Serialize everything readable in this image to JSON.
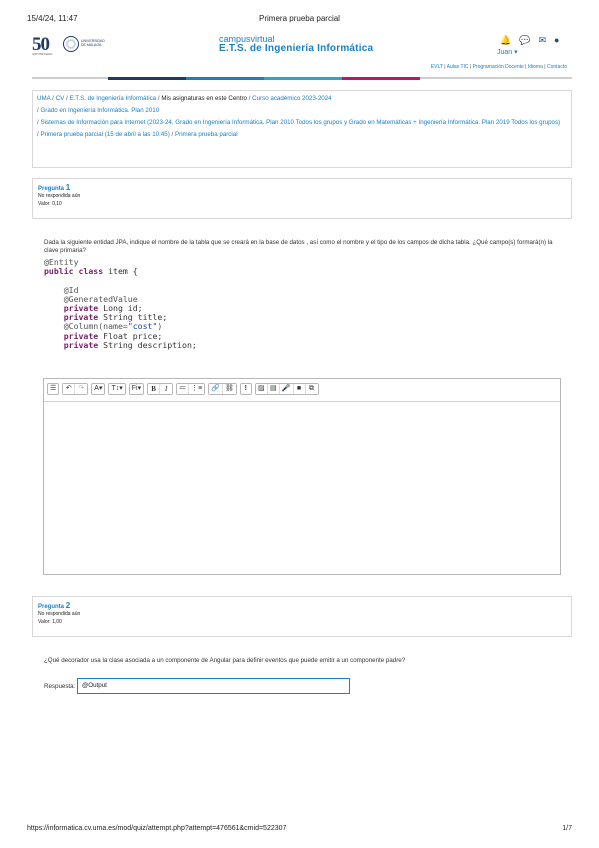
{
  "print_header": {
    "date": "15/4/24, 11:47",
    "title": "Primera prueba parcial"
  },
  "logo": {
    "fifty": "50",
    "fifty_sub": "ANIVERSARIO",
    "univ_line1": "UNIVERSIDAD",
    "univ_line2": "DE MÁLAGA"
  },
  "brand": {
    "line1": "campusvirtual",
    "line2": "E.T.S. de Ingeniería Informática"
  },
  "user": {
    "name": "Juan",
    "caret": "▾"
  },
  "icons": [
    "bell-icon",
    "chat-icon",
    "mail-icon",
    "help-icon"
  ],
  "top_links": [
    "EVLT",
    "Aulas TIC",
    "Programación Docente",
    "Idioma",
    "Contacto"
  ],
  "colors": {
    "accent": "#1b7fc4",
    "bar": [
      "#1f3a66",
      "#1b7fc4",
      "#2aa6c9",
      "#c0136b",
      "#cfcfcf"
    ]
  },
  "breadcrumb": {
    "items1": [
      "UMA",
      "CV",
      "E.T.S. de Ingeniería Informática"
    ],
    "current": "Mis asignaturas en este Centro",
    "after": "Curso académico 2023-2024",
    "line2": "Grado en Ingeniería Informática. Plan 2010",
    "line3": "Sistemas de Información para Internet (2023-24, Grado en Ingeniería Informática. Plan 2010 Todos los grupos y Grado en Matemáticas + Ingeniería Informática. Plan 2019 Todos los grupos)",
    "line4a": "Primera prueba parcial (15 de abril a las 10:45)",
    "line4b": "Primera prueba parcial"
  },
  "q1": {
    "label": "Pregunta",
    "number": "1",
    "status": "No respondida aún",
    "value": "Valor: 0,10",
    "text": "Dada la siguiente entidad JPA, indique el nombre de la tabla que se creará en la base de datos , así como el nombre y el tipo de los campos de dicha tabla. ¿Qué campo(s) formará(n) la clave primaria?",
    "code": {
      "l1": "@Entity",
      "l2_kw": "public class",
      "l2_rest": " item {",
      "l3": "@Id",
      "l4": "@GeneratedValue",
      "l5_kw": "private",
      "l5_rest": " Long id;",
      "l6_kw": "private",
      "l6_rest": " String title;",
      "l7_a": "@Column(name=",
      "l7_str": "\"cost\"",
      "l7_b": ")",
      "l8_kw": "private",
      "l8_rest": " Float price;",
      "l9_kw": "private",
      "l9_rest": " String description;"
    }
  },
  "toolbar": {
    "b1": "☰",
    "b2": "↶",
    "b3": "↷",
    "b4": "A▾",
    "b5": "T↕▾",
    "b6": "Fi▾",
    "b7": "B",
    "b8": "I",
    "b9": "≔",
    "b10": "⋮≡",
    "b11": "🔗",
    "b12": "⛓",
    "b13": "!",
    "b14": "▨",
    "b15": "▤",
    "b16": "🎤",
    "b17": "■",
    "b18": "⧉"
  },
  "q2": {
    "label": "Pregunta",
    "number": "2",
    "status": "No respondida aún",
    "value": "Valor: 1,00",
    "text": "¿Qué decorador usa la clase asociada a un componente de Angular para definir eventos que puede emitir a un componente padre?",
    "answer_label": "Respuesta:",
    "answer_value": "@Output"
  },
  "footer": {
    "url": "https://informatica.cv.uma.es/mod/quiz/attempt.php?attempt=476561&cmid=522307",
    "page": "1/7"
  }
}
